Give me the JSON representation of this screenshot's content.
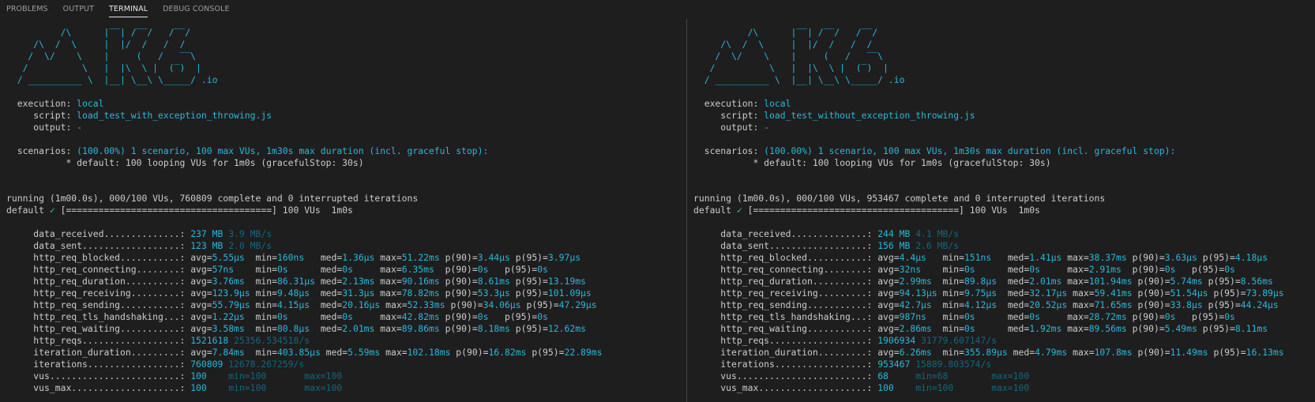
{
  "tabs": [
    {
      "label": "PROBLEMS",
      "active": false
    },
    {
      "label": "OUTPUT",
      "active": false
    },
    {
      "label": "TERMINAL",
      "active": true
    },
    {
      "label": "DEBUG CONSOLE",
      "active": false
    }
  ],
  "colors": {
    "background": "#1e1e1e",
    "text": "#cccccc",
    "cyan": "#29b8db",
    "dim_cyan": "#13677d",
    "green": "#23d18b",
    "divider": "#444444"
  },
  "logo_text": ".io",
  "logo_lines": [
    "          /\\      |‾‾| /‾‾/   /‾‾/   ",
    "     /\\  /  \\     |  |/  /   /  /    ",
    "    /  \\/    \\    |     (   /   ‾‾\\  ",
    "   /          \\   |  |\\  \\ |  (‾)  | ",
    "  / __________ \\  |__| \\__\\ \\_____/ "
  ],
  "panes": [
    {
      "name": "with-exception",
      "execution_label": "execution:",
      "execution": "local",
      "script_label": "script:",
      "script": "load_test_with_exception_throwing.js",
      "output_label": "output:",
      "output": "-",
      "scenarios_label": "scenarios:",
      "scenarios": "(100.00%) 1 scenario, 100 max VUs, 1m30s max duration (incl. graceful stop):",
      "default_line": "* default: 100 looping VUs for 1m0s (gracefulStop: 30s)",
      "running": "running (1m00.0s), 000/100 VUs, 760809 complete and 0 interrupted iterations",
      "progress_prefix": "default",
      "progress_check": "✓",
      "progress_bar": "[======================================]",
      "progress_suffix": "100 VUs  1m0s",
      "metrics": [
        {
          "label": "data_received",
          "values": [
            {
              "t": "237 MB",
              "dim": false
            },
            {
              "t": "3.9 MB/s",
              "dim": true
            }
          ]
        },
        {
          "label": "data_sent",
          "values": [
            {
              "t": "123 MB",
              "dim": false
            },
            {
              "t": "2.0 MB/s",
              "dim": true
            }
          ]
        },
        {
          "label": "http_req_blocked",
          "stats": {
            "avg": "5.55µs",
            "min": "160ns",
            "med": "1.36µs",
            "max": "51.22ms",
            "p90": "3.44µs",
            "p95": "3.97µs"
          }
        },
        {
          "label": "http_req_connecting",
          "stats": {
            "avg": "57ns",
            "min": "0s",
            "med": "0s",
            "max": "6.35ms",
            "p90": "0s",
            "p95": "0s"
          }
        },
        {
          "label": "http_req_duration",
          "stats": {
            "avg": "3.76ms",
            "min": "86.31µs",
            "med": "2.13ms",
            "max": "90.16ms",
            "p90": "8.61ms",
            "p95": "13.19ms"
          }
        },
        {
          "label": "http_req_receiving",
          "stats": {
            "avg": "123.9µs",
            "min": "9.48µs",
            "med": "31.3µs",
            "max": "78.82ms",
            "p90": "53.3µs",
            "p95": "101.09µs"
          }
        },
        {
          "label": "http_req_sending",
          "stats": {
            "avg": "55.79µs",
            "min": "4.15µs",
            "med": "20.16µs",
            "max": "52.33ms",
            "p90": "34.06µs",
            "p95": "47.29µs"
          }
        },
        {
          "label": "http_req_tls_handshaking",
          "stats": {
            "avg": "1.22µs",
            "min": "0s",
            "med": "0s",
            "max": "42.82ms",
            "p90": "0s",
            "p95": "0s"
          }
        },
        {
          "label": "http_req_waiting",
          "stats": {
            "avg": "3.58ms",
            "min": "80.8µs",
            "med": "2.01ms",
            "max": "89.86ms",
            "p90": "8.18ms",
            "p95": "12.62ms"
          }
        },
        {
          "label": "http_reqs",
          "values": [
            {
              "t": "1521618",
              "dim": false
            },
            {
              "t": "25356.534518/s",
              "dim": true
            }
          ]
        },
        {
          "label": "iteration_duration",
          "stats": {
            "avg": "7.84ms",
            "min": "403.85µs",
            "med": "5.59ms",
            "max": "102.18ms",
            "p90": "16.82ms",
            "p95": "22.89ms"
          }
        },
        {
          "label": "iterations",
          "values": [
            {
              "t": "760809",
              "dim": false
            },
            {
              "t": "12678.267259/s",
              "dim": true
            }
          ]
        },
        {
          "label": "vus",
          "values": [
            {
              "t": "100",
              "dim": false
            },
            {
              "t": "min=100",
              "dim": true
            },
            {
              "t": "max=100",
              "dim": true
            }
          ]
        },
        {
          "label": "vus_max",
          "values": [
            {
              "t": "100",
              "dim": false
            },
            {
              "t": "min=100",
              "dim": true
            },
            {
              "t": "max=100",
              "dim": true
            }
          ]
        }
      ]
    },
    {
      "name": "without-exception",
      "execution_label": "execution:",
      "execution": "local",
      "script_label": "script:",
      "script": "load_test_without_exception_throwing.js",
      "output_label": "output:",
      "output": "-",
      "scenarios_label": "scenarios:",
      "scenarios": "(100.00%) 1 scenario, 100 max VUs, 1m30s max duration (incl. graceful stop):",
      "default_line": "* default: 100 looping VUs for 1m0s (gracefulStop: 30s)",
      "running": "running (1m00.0s), 000/100 VUs, 953467 complete and 0 interrupted iterations",
      "progress_prefix": "default",
      "progress_check": "✓",
      "progress_bar": "[======================================]",
      "progress_suffix": "100 VUs  1m0s",
      "metrics": [
        {
          "label": "data_received",
          "values": [
            {
              "t": "244 MB",
              "dim": false
            },
            {
              "t": "4.1 MB/s",
              "dim": true
            }
          ]
        },
        {
          "label": "data_sent",
          "values": [
            {
              "t": "156 MB",
              "dim": false
            },
            {
              "t": "2.6 MB/s",
              "dim": true
            }
          ]
        },
        {
          "label": "http_req_blocked",
          "stats": {
            "avg": "4.4µs",
            "min": "151ns",
            "med": "1.41µs",
            "max": "38.37ms",
            "p90": "3.63µs",
            "p95": "4.18µs"
          }
        },
        {
          "label": "http_req_connecting",
          "stats": {
            "avg": "32ns",
            "min": "0s",
            "med": "0s",
            "max": "2.91ms",
            "p90": "0s",
            "p95": "0s"
          }
        },
        {
          "label": "http_req_duration",
          "stats": {
            "avg": "2.99ms",
            "min": "89.8µs",
            "med": "2.01ms",
            "max": "101.94ms",
            "p90": "5.74ms",
            "p95": "8.56ms"
          }
        },
        {
          "label": "http_req_receiving",
          "stats": {
            "avg": "94.13µs",
            "min": "9.75µs",
            "med": "32.17µs",
            "max": "59.41ms",
            "p90": "51.54µs",
            "p95": "73.89µs"
          }
        },
        {
          "label": "http_req_sending",
          "stats": {
            "avg": "42.7µs",
            "min": "4.12µs",
            "med": "20.52µs",
            "max": "71.65ms",
            "p90": "33.8µs",
            "p95": "44.24µs"
          }
        },
        {
          "label": "http_req_tls_handshaking",
          "stats": {
            "avg": "987ns",
            "min": "0s",
            "med": "0s",
            "max": "28.72ms",
            "p90": "0s",
            "p95": "0s"
          }
        },
        {
          "label": "http_req_waiting",
          "stats": {
            "avg": "2.86ms",
            "min": "0s",
            "med": "1.92ms",
            "max": "89.56ms",
            "p90": "5.49ms",
            "p95": "8.11ms"
          }
        },
        {
          "label": "http_reqs",
          "values": [
            {
              "t": "1906934",
              "dim": false
            },
            {
              "t": "31779.607147/s",
              "dim": true
            }
          ]
        },
        {
          "label": "iteration_duration",
          "stats": {
            "avg": "6.26ms",
            "min": "355.89µs",
            "med": "4.79ms",
            "max": "107.8ms",
            "p90": "11.49ms",
            "p95": "16.13ms"
          }
        },
        {
          "label": "iterations",
          "values": [
            {
              "t": "953467",
              "dim": false
            },
            {
              "t": "15889.803574/s",
              "dim": true
            }
          ]
        },
        {
          "label": "vus",
          "values": [
            {
              "t": "68",
              "dim": false
            },
            {
              "t": "min=68",
              "dim": true
            },
            {
              "t": "max=100",
              "dim": true
            }
          ]
        },
        {
          "label": "vus_max",
          "values": [
            {
              "t": "100",
              "dim": false
            },
            {
              "t": "min=100",
              "dim": true
            },
            {
              "t": "max=100",
              "dim": true
            }
          ]
        }
      ]
    }
  ]
}
